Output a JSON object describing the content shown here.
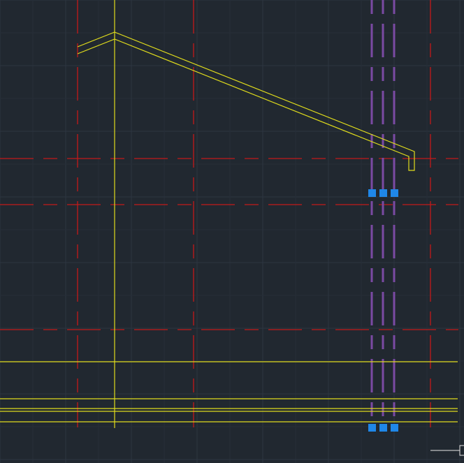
{
  "canvas": {
    "background_color": "#212830",
    "grid_minor_color": "#262e37",
    "grid_major_color": "#2d3641"
  },
  "layers": {
    "centerline": {
      "color": "#c41a1a",
      "linetype": "dashed"
    },
    "geometry": {
      "color": "#e0dc1c",
      "linetype": "continuous"
    },
    "selected": {
      "color": "#7a4aa3",
      "linetype": "dashed"
    },
    "grips": {
      "color": "#1f87e8"
    },
    "ucs": {
      "color": "#e6e6e6"
    }
  },
  "selection": {
    "count": 3,
    "grip_count": 6
  }
}
